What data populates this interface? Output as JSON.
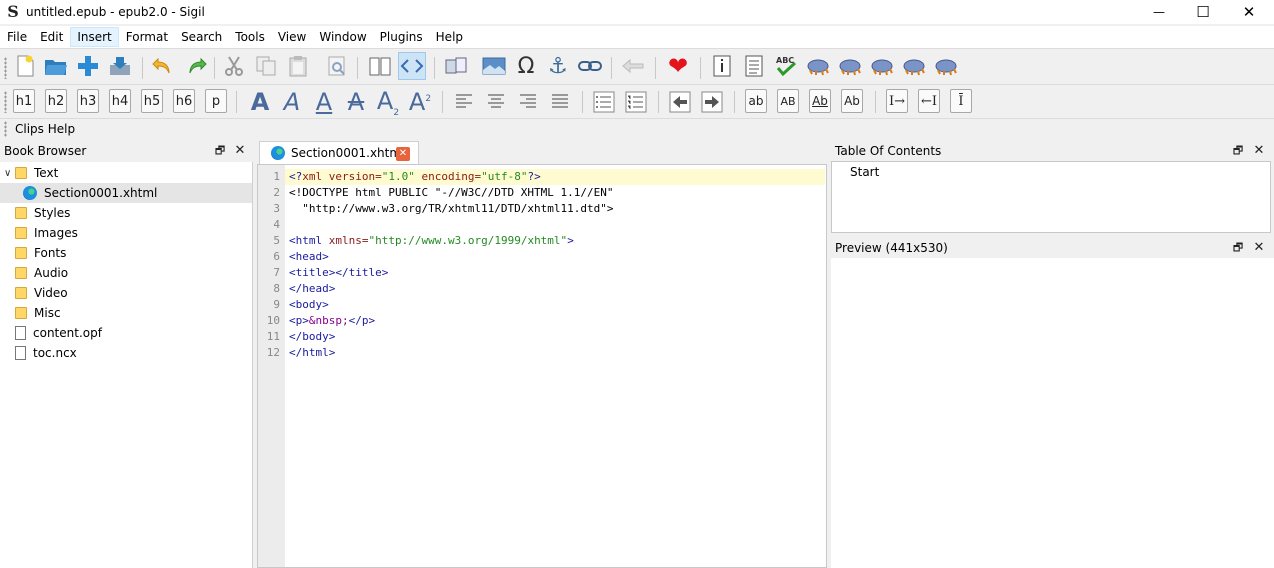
{
  "window": {
    "title": "untitled.epub - epub2.0 - Sigil",
    "app_icon": "S",
    "minimize": "—",
    "maximize": "☐",
    "close": "✕"
  },
  "menu": [
    "File",
    "Edit",
    "Insert",
    "Format",
    "Search",
    "Tools",
    "View",
    "Window",
    "Plugins",
    "Help"
  ],
  "menu_active": "Insert",
  "toolbar2": {
    "headings": [
      "h1",
      "h2",
      "h3",
      "h4",
      "h5",
      "h6",
      "p"
    ],
    "case_buttons": [
      "ab",
      "AB",
      "Ab",
      "Ab"
    ]
  },
  "clips": {
    "label": "Clips Help"
  },
  "book_browser": {
    "title": "Book Browser",
    "items": [
      {
        "label": "Text",
        "kind": "folder"
      },
      {
        "label": "Section0001.xhtml",
        "kind": "xhtml"
      },
      {
        "label": "Styles",
        "kind": "folder"
      },
      {
        "label": "Images",
        "kind": "folder"
      },
      {
        "label": "Fonts",
        "kind": "folder"
      },
      {
        "label": "Audio",
        "kind": "folder"
      },
      {
        "label": "Video",
        "kind": "folder"
      },
      {
        "label": "Misc",
        "kind": "folder"
      },
      {
        "label": "content.opf",
        "kind": "file"
      },
      {
        "label": "toc.ncx",
        "kind": "file"
      }
    ]
  },
  "editor": {
    "tab_label": "Section0001.xhtml",
    "line_numbers": [
      "1",
      "2",
      "3",
      "4",
      "5",
      "6",
      "7",
      "8",
      "9",
      "10",
      "11",
      "12"
    ],
    "lines": [
      {
        "t1": "<?",
        "a1": "xml version=",
        "s1": "\"1.0\"",
        "a2": " encoding=",
        "s2": "\"utf-8\"",
        "t2": "?>"
      },
      {
        "tag": "<!DOCTYPE html PUBLIC \"-//W3C//DTD XHTML 1.1//EN\""
      },
      {
        "tag": "  \"http://www.w3.org/TR/xhtml11/DTD/xhtml11.dtd\">"
      },
      {
        "tag": ""
      },
      {
        "t1": "<html ",
        "a1": "xmlns=",
        "s1": "\"http://www.w3.org/1999/xhtml\"",
        "t2": ">"
      },
      {
        "tag": "<head>"
      },
      {
        "tag": "<title></title>"
      },
      {
        "tag": "</head>"
      },
      {
        "tag": "<body>"
      },
      {
        "t1": "<p>",
        "ent": "&nbsp;",
        "t2": "</p>"
      },
      {
        "tag": "</body>"
      },
      {
        "tag": "</html>"
      }
    ]
  },
  "toc": {
    "title": "Table Of Contents",
    "items": [
      "Start"
    ]
  },
  "preview": {
    "title": "Preview (441x530)"
  },
  "colors": {
    "selected_row": "#e5e5e5",
    "current_line": "#fffbd0",
    "tag": "#1b1b9e",
    "attr": "#8b1a1a",
    "string": "#228b22"
  }
}
